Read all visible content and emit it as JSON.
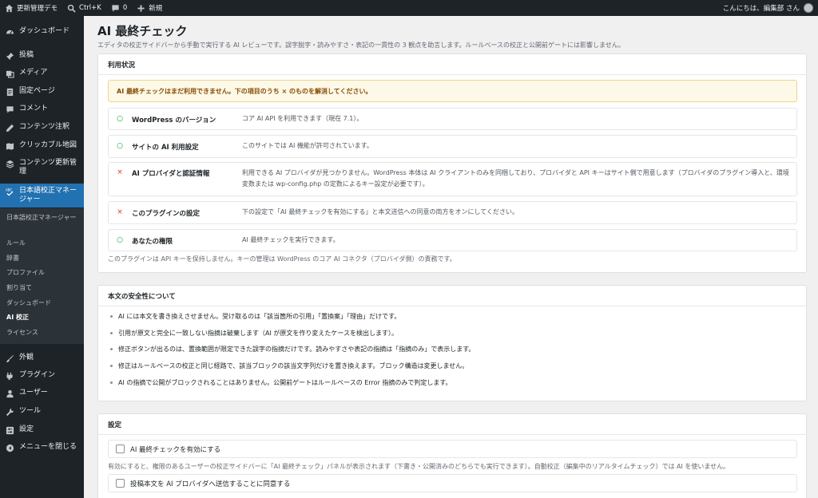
{
  "adminbar": {
    "site_name": "更新管理デモ",
    "search_shortcut": "Ctrl+K",
    "comments_count": "0",
    "new_label": "新規",
    "greeting": "こんにちは、編集部 さん"
  },
  "sidebar": {
    "items": [
      {
        "label": "ダッシュボード",
        "icon": "dashboard-icon"
      },
      {
        "label": "投稿",
        "icon": "pin-icon"
      },
      {
        "label": "メディア",
        "icon": "media-icon"
      },
      {
        "label": "固定ページ",
        "icon": "page-icon"
      },
      {
        "label": "コメント",
        "icon": "comment-icon"
      },
      {
        "label": "コンテンツ注釈",
        "icon": "pen-icon"
      },
      {
        "label": "クリッカブル地図",
        "icon": "map-icon"
      },
      {
        "label": "コンテンツ更新管理",
        "icon": "stack-icon"
      },
      {
        "label": "日本語校正マネージャー",
        "icon": "abc-check-icon"
      }
    ],
    "submenu": [
      "日本語校正マネージャー",
      "ルール",
      "辞書",
      "プロファイル",
      "割り当て",
      "ダッシュボード",
      "AI 校正",
      "ライセンス"
    ],
    "bottom_items": [
      {
        "label": "外観",
        "icon": "brush-icon"
      },
      {
        "label": "プラグイン",
        "icon": "plugin-icon"
      },
      {
        "label": "ユーザー",
        "icon": "user-icon"
      },
      {
        "label": "ツール",
        "icon": "wrench-icon"
      },
      {
        "label": "設定",
        "icon": "settings-icon"
      },
      {
        "label": "メニューを閉じる",
        "icon": "collapse-icon"
      }
    ]
  },
  "page": {
    "title": "AI 最終チェック",
    "description": "エディタの校正サイドバーから手動で実行する AI レビューです。誤字脱字・読みやすさ・表記の一貫性の 3 観点を助言します。ルールベースの校正と公開前ゲートには影響しません。"
  },
  "usage": {
    "heading": "利用状況",
    "notice": "AI 最終チェックはまだ利用できません。下の項目のうち × のものを解消してください。",
    "rows": [
      {
        "status": "ok",
        "icon": "○",
        "label": "WordPress のバージョン",
        "desc": "コア AI API を利用できます（現在 7.1）。"
      },
      {
        "status": "ok",
        "icon": "○",
        "label": "サイトの AI 利用設定",
        "desc": "このサイトでは AI 機能が許可されています。"
      },
      {
        "status": "ng",
        "icon": "×",
        "label": "AI プロバイダと認証情報",
        "desc": "利用できる AI プロバイダが見つかりません。WordPress 本体は AI クライアントのみを同梱しており、プロバイダと API キーはサイト側で用意します（プロバイダのプラグイン導入と、環境変数または wp-config.php の定数によるキー設定が必要です）。"
      },
      {
        "status": "ng",
        "icon": "×",
        "label": "このプラグインの設定",
        "desc": "下の設定で「AI 最終チェックを有効にする」と本文送信への同意の両方をオンにしてください。"
      },
      {
        "status": "ok",
        "icon": "○",
        "label": "あなたの権限",
        "desc": "AI 最終チェックを実行できます。"
      }
    ],
    "footnote": "このプラグインは API キーを保持しません。キーの管理は WordPress のコア AI コネクタ（プロバイダ側）の責務です。"
  },
  "safety": {
    "heading": "本文の安全性について",
    "bullets": [
      "AI には本文を書き換えさせません。受け取るのは「該当箇所の引用」「置換案」「理由」だけです。",
      "引用が原文と完全に一致しない指摘は破棄します（AI が原文を作り変えたケースを検出します）。",
      "修正ボタンが出るのは、置換範囲が限定できた誤字の指摘だけです。読みやすさや表記の指摘は「指摘のみ」で表示します。",
      "修正はルールベースの校正と同じ経路で、該当ブロックの該当文字列だけを置き換えます。ブロック構造は変更しません。",
      "AI の指摘で公開がブロックされることはありません。公開前ゲートはルールベースの Error 指摘のみで判定します。"
    ]
  },
  "settings": {
    "heading": "設定",
    "enable_label": "AI 最終チェックを有効にする",
    "enable_checked": false,
    "enable_help": "有効にすると、権限のあるユーザーの校正サイドバーに「AI 最終チェック」パネルが表示されます（下書き・公開済みのどちらでも実行できます）。自動校正（編集中のリアルタイムチェック）では AI を使いません。",
    "consent_label": "投稿本文を AI プロバイダへ送信することに同意する",
    "consent_checked": false
  },
  "colors": {
    "adminbar_bg": "#1d2327",
    "sidebar_bg": "#1d2327",
    "submenu_bg": "#2c3338",
    "accent": "#2271b1",
    "ok": "#00a32a",
    "error": "#d63638",
    "notice_bg": "#fcf9e8"
  }
}
